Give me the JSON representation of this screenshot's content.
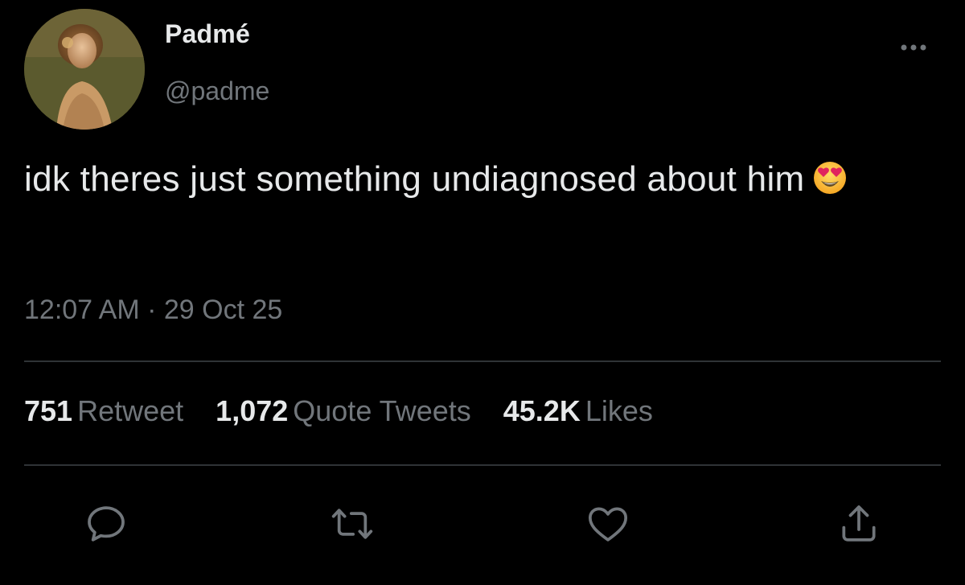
{
  "user": {
    "display_name": "Padmé",
    "handle": "@padme"
  },
  "tweet": {
    "text": "idk theres just something undiagnosed about him",
    "emoji": "smiling-face-with-heart-eyes",
    "timestamp": "12:07 AM · 29 Oct 25"
  },
  "stats": [
    {
      "count": "751",
      "label": "Retweet"
    },
    {
      "count": "1,072",
      "label": "Quote Tweets"
    },
    {
      "count": "45.2K",
      "label": "Likes"
    }
  ],
  "actions": [
    "reply-icon",
    "retweet-icon",
    "like-icon",
    "share-icon"
  ],
  "colors": {
    "background": "#000000",
    "primary_text": "#e7e9ea",
    "secondary_text": "#71767b",
    "divider": "#2f3336"
  }
}
